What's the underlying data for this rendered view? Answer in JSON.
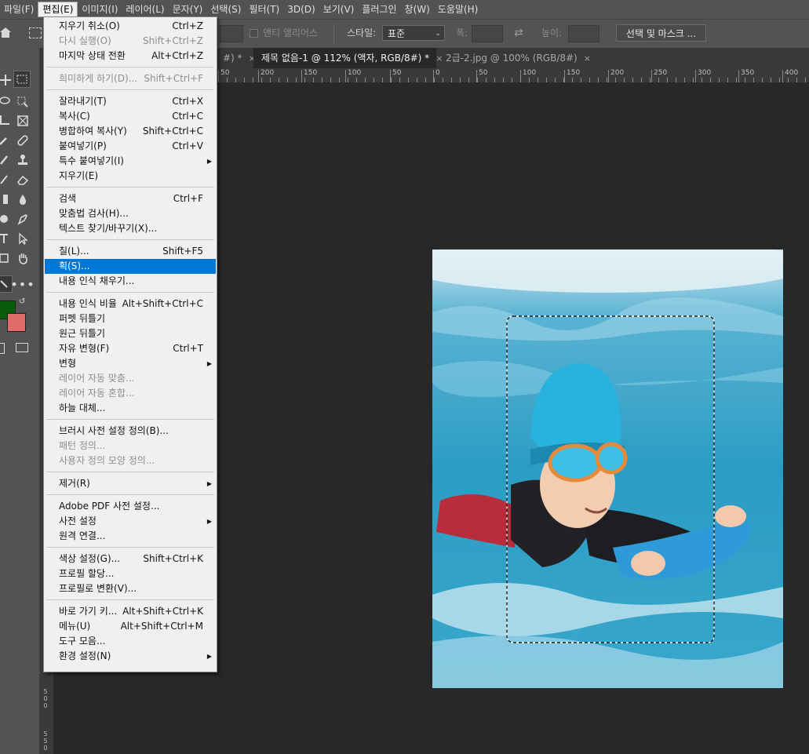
{
  "menubar": {
    "items": [
      "파일(F)",
      "편집(E)",
      "이미지(I)",
      "레이어(L)",
      "문자(Y)",
      "선택(S)",
      "필터(T)",
      "3D(D)",
      "보기(V)",
      "플러그인",
      "창(W)",
      "도움말(H)"
    ]
  },
  "options": {
    "antialias": "앤티 앨리어스",
    "style_label": "스타일:",
    "style_value": "표준",
    "width_label": "폭:",
    "height_label": "높이:",
    "select_mask": "선택 및 마스크 ..."
  },
  "tabs": [
    {
      "label": "#) *",
      "close": "×"
    },
    {
      "label": "제목 없음-1 @ 112% (액자, RGB/8#) *",
      "close": "×"
    },
    {
      "label": "2급-2.jpg @ 100% (RGB/8#)",
      "close": "×"
    }
  ],
  "ruler": {
    "h_labels": [
      "50",
      "200",
      "150",
      "100",
      "50",
      "0",
      "50",
      "100",
      "150",
      "200",
      "250",
      "300",
      "350",
      "400"
    ],
    "v_labels": [
      "5\n0\n0",
      "5\n5\n0"
    ]
  },
  "colors": {
    "foreground": "#0a5c0a",
    "background": "#e06b6b",
    "highlight": "#0078d7"
  },
  "edit_menu": {
    "items": [
      {
        "label": "지우기 취소(O)",
        "shortcut": "Ctrl+Z",
        "disabled": false,
        "submenu": false
      },
      {
        "label": "다시 실행(O)",
        "shortcut": "Shift+Ctrl+Z",
        "disabled": true,
        "submenu": false
      },
      {
        "label": "마지막 상태 전환",
        "shortcut": "Alt+Ctrl+Z",
        "disabled": false,
        "submenu": false
      },
      {
        "sep": true
      },
      {
        "label": "희미하게 하기(D)...",
        "shortcut": "Shift+Ctrl+F",
        "disabled": true,
        "submenu": false
      },
      {
        "sep": true
      },
      {
        "label": "잘라내기(T)",
        "shortcut": "Ctrl+X",
        "disabled": false,
        "submenu": false
      },
      {
        "label": "복사(C)",
        "shortcut": "Ctrl+C",
        "disabled": false,
        "submenu": false
      },
      {
        "label": "병합하여 복사(Y)",
        "shortcut": "Shift+Ctrl+C",
        "disabled": false,
        "submenu": false
      },
      {
        "label": "붙여넣기(P)",
        "shortcut": "Ctrl+V",
        "disabled": false,
        "submenu": false
      },
      {
        "label": "특수 붙여넣기(I)",
        "shortcut": "",
        "disabled": false,
        "submenu": true
      },
      {
        "label": "지우기(E)",
        "shortcut": "",
        "disabled": false,
        "submenu": false
      },
      {
        "sep": true
      },
      {
        "label": "검색",
        "shortcut": "Ctrl+F",
        "disabled": false,
        "submenu": false
      },
      {
        "label": "맞춤법 검사(H)...",
        "shortcut": "",
        "disabled": false,
        "submenu": false
      },
      {
        "label": "텍스트 찾기/바꾸기(X)...",
        "shortcut": "",
        "disabled": false,
        "submenu": false
      },
      {
        "sep": true
      },
      {
        "label": "칠(L)...",
        "shortcut": "Shift+F5",
        "disabled": false,
        "submenu": false
      },
      {
        "label": "획(S)...",
        "shortcut": "",
        "disabled": false,
        "submenu": false,
        "highlight": true
      },
      {
        "label": "내용 인식 채우기...",
        "shortcut": "",
        "disabled": false,
        "submenu": false
      },
      {
        "sep": true
      },
      {
        "label": "내용 인식 비율",
        "shortcut": "Alt+Shift+Ctrl+C",
        "disabled": false,
        "submenu": false
      },
      {
        "label": "퍼펫 뒤틀기",
        "shortcut": "",
        "disabled": false,
        "submenu": false
      },
      {
        "label": "원근 뒤틀기",
        "shortcut": "",
        "disabled": false,
        "submenu": false
      },
      {
        "label": "자유 변형(F)",
        "shortcut": "Ctrl+T",
        "disabled": false,
        "submenu": false
      },
      {
        "label": "변형",
        "shortcut": "",
        "disabled": false,
        "submenu": true
      },
      {
        "label": "레이어 자동 맞춤...",
        "shortcut": "",
        "disabled": true,
        "submenu": false
      },
      {
        "label": "레이어 자동 혼합...",
        "shortcut": "",
        "disabled": true,
        "submenu": false
      },
      {
        "label": "하늘 대체...",
        "shortcut": "",
        "disabled": false,
        "submenu": false
      },
      {
        "sep": true
      },
      {
        "label": "브러시 사전 설정 정의(B)...",
        "shortcut": "",
        "disabled": false,
        "submenu": false
      },
      {
        "label": "패턴 정의...",
        "shortcut": "",
        "disabled": true,
        "submenu": false
      },
      {
        "label": "사용자 정의 모양 정의...",
        "shortcut": "",
        "disabled": true,
        "submenu": false
      },
      {
        "sep": true
      },
      {
        "label": "제거(R)",
        "shortcut": "",
        "disabled": false,
        "submenu": true
      },
      {
        "sep": true
      },
      {
        "label": "Adobe PDF 사전 설정...",
        "shortcut": "",
        "disabled": false,
        "submenu": false
      },
      {
        "label": "사전 설정",
        "shortcut": "",
        "disabled": false,
        "submenu": true
      },
      {
        "label": "원격 연결...",
        "shortcut": "",
        "disabled": false,
        "submenu": false
      },
      {
        "sep": true
      },
      {
        "label": "색상 설정(G)...",
        "shortcut": "Shift+Ctrl+K",
        "disabled": false,
        "submenu": false
      },
      {
        "label": "프로필 할당...",
        "shortcut": "",
        "disabled": false,
        "submenu": false
      },
      {
        "label": "프로필로 변환(V)...",
        "shortcut": "",
        "disabled": false,
        "submenu": false
      },
      {
        "sep": true
      },
      {
        "label": "바로 가기 키...",
        "shortcut": "Alt+Shift+Ctrl+K",
        "disabled": false,
        "submenu": false
      },
      {
        "label": "메뉴(U)",
        "shortcut": "Alt+Shift+Ctrl+M",
        "disabled": false,
        "submenu": false
      },
      {
        "label": "도구 모음...",
        "shortcut": "",
        "disabled": false,
        "submenu": false
      },
      {
        "label": "환경 설정(N)",
        "shortcut": "",
        "disabled": false,
        "submenu": true
      }
    ]
  }
}
